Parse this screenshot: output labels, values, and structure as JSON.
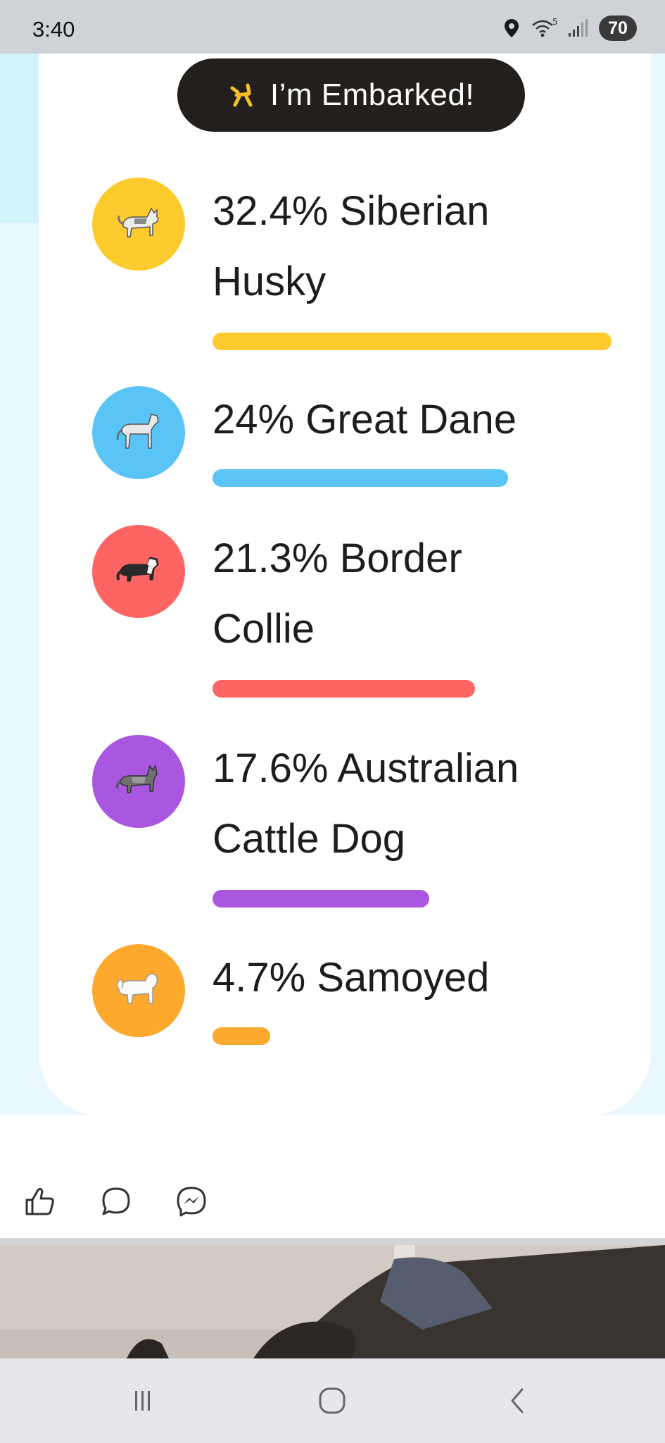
{
  "status_bar": {
    "time": "3:40",
    "wifi_superscript": "5",
    "battery": "70"
  },
  "badge": {
    "icon": "balloon-dog-icon",
    "label": "I’m Embarked!"
  },
  "breeds": [
    {
      "line1": "32.4% Siberian",
      "line2": "Husky",
      "percent": 32.4,
      "color": "#fdcb2e",
      "icon": "siberian-husky-icon"
    },
    {
      "line1": "24% Great Dane",
      "line2": "",
      "percent": 24,
      "color": "#5ac4f6",
      "icon": "great-dane-icon"
    },
    {
      "line1": "21.3% Border",
      "line2": "Collie",
      "percent": 21.3,
      "color": "#fc6563",
      "icon": "border-collie-icon"
    },
    {
      "line1": "17.6% Australian",
      "line2": "Cattle Dog",
      "percent": 17.6,
      "color": "#a957e0",
      "icon": "australian-cattle-dog-icon"
    },
    {
      "line1": "4.7% Samoyed",
      "line2": "",
      "percent": 4.7,
      "color": "#fda92e",
      "icon": "samoyed-icon"
    }
  ],
  "actions": [
    "like-icon",
    "comment-icon",
    "messenger-icon"
  ],
  "nav": [
    "recent-apps-icon",
    "home-icon",
    "back-icon"
  ]
}
